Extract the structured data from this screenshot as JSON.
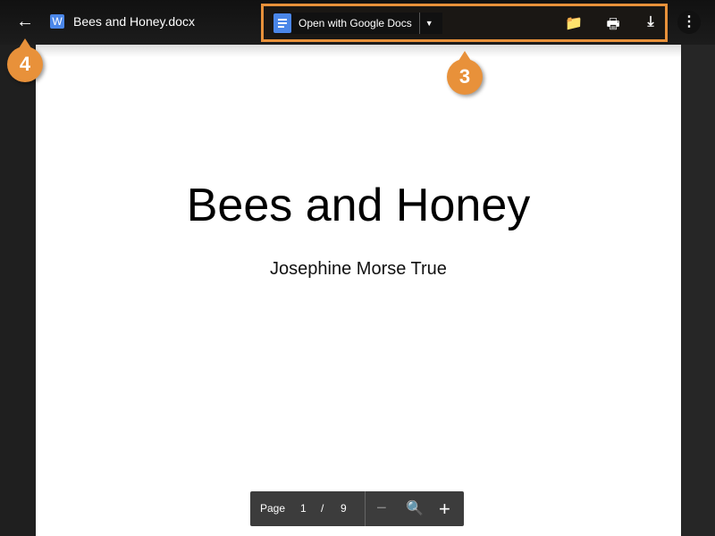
{
  "header": {
    "back_icon": "arrow-left-icon",
    "file_icon": "word-icon",
    "file_icon_letter": "W",
    "file_name": "Bees and Honey.docx"
  },
  "toolbar": {
    "open_with_label": "Open with Google Docs",
    "icons": [
      "add-to-drive-icon",
      "print-icon",
      "download-icon"
    ],
    "more_icon": "more-vert-icon"
  },
  "document": {
    "title": "Bees and Honey",
    "author": "Josephine Morse True"
  },
  "pager": {
    "page_label": "Page",
    "current_page": "1",
    "separator": "/",
    "total_pages": "9"
  },
  "callouts": {
    "toolbar": "3",
    "back": "4"
  },
  "colors": {
    "callout": "#e8913a",
    "docs_blue": "#4a86e8"
  }
}
